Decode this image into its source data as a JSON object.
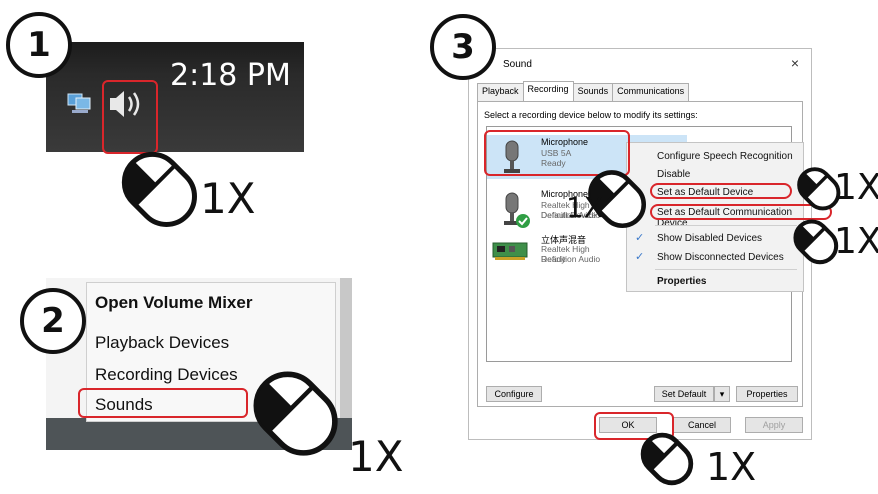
{
  "steps": {
    "step1": {
      "number": "1",
      "clock": "2:18 PM",
      "click_count": "1X",
      "icons": [
        "network-icon",
        "speaker-icon"
      ]
    },
    "step2": {
      "number": "2",
      "menu": [
        "Open Volume Mixer",
        "Playback Devices",
        "Recording Devices",
        "Sounds"
      ],
      "highlighted": "Sounds",
      "click_count": "1X"
    },
    "step3": {
      "number": "3",
      "dialog_title": "Sound",
      "close_glyph": "×",
      "tabs": [
        "Playback",
        "Recording",
        "Sounds",
        "Communications"
      ],
      "active_tab": "Recording",
      "instruction": "Select a recording device below to modify its settings:",
      "devices": [
        {
          "name": "Microphone",
          "line1": "USB 5A",
          "line2": "Ready"
        },
        {
          "name": "Microphone",
          "line1": "Realtek High Definition Audio",
          "line2": "Default Device"
        },
        {
          "name": "立体声混音",
          "line1": "Realtek High Definition Audio",
          "line2": "Ready"
        }
      ],
      "context_menu": {
        "items": [
          "Configure Speech Recognition",
          "Disable",
          "Set as Default Device",
          "Set as Default Communication Device",
          "Show Disabled Devices",
          "Show Disconnected Devices",
          "Properties"
        ],
        "check_glyph": "✓"
      },
      "buttons": {
        "configure": "Configure",
        "set_default": "Set Default",
        "dropdown_glyph": "▾",
        "properties": "Properties",
        "ok": "OK",
        "cancel": "Cancel",
        "apply": "Apply"
      },
      "click_counts": [
        "1X",
        "1X",
        "1X",
        "1X"
      ]
    }
  },
  "colors": {
    "highlight_red": "#d9262b",
    "selection_blue": "#cce4f7",
    "ink": "#111111"
  }
}
